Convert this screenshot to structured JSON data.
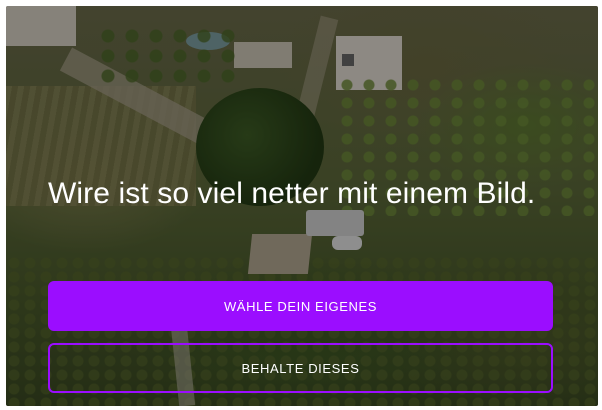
{
  "onboarding": {
    "headline": "Wire ist so viel netter mit einem Bild.",
    "choose_own_label": "WÄHLE DEIN EIGENES",
    "keep_this_label": "BEHALTE DIESES"
  },
  "colors": {
    "accent": "#9b0dff",
    "text": "#ffffff"
  }
}
